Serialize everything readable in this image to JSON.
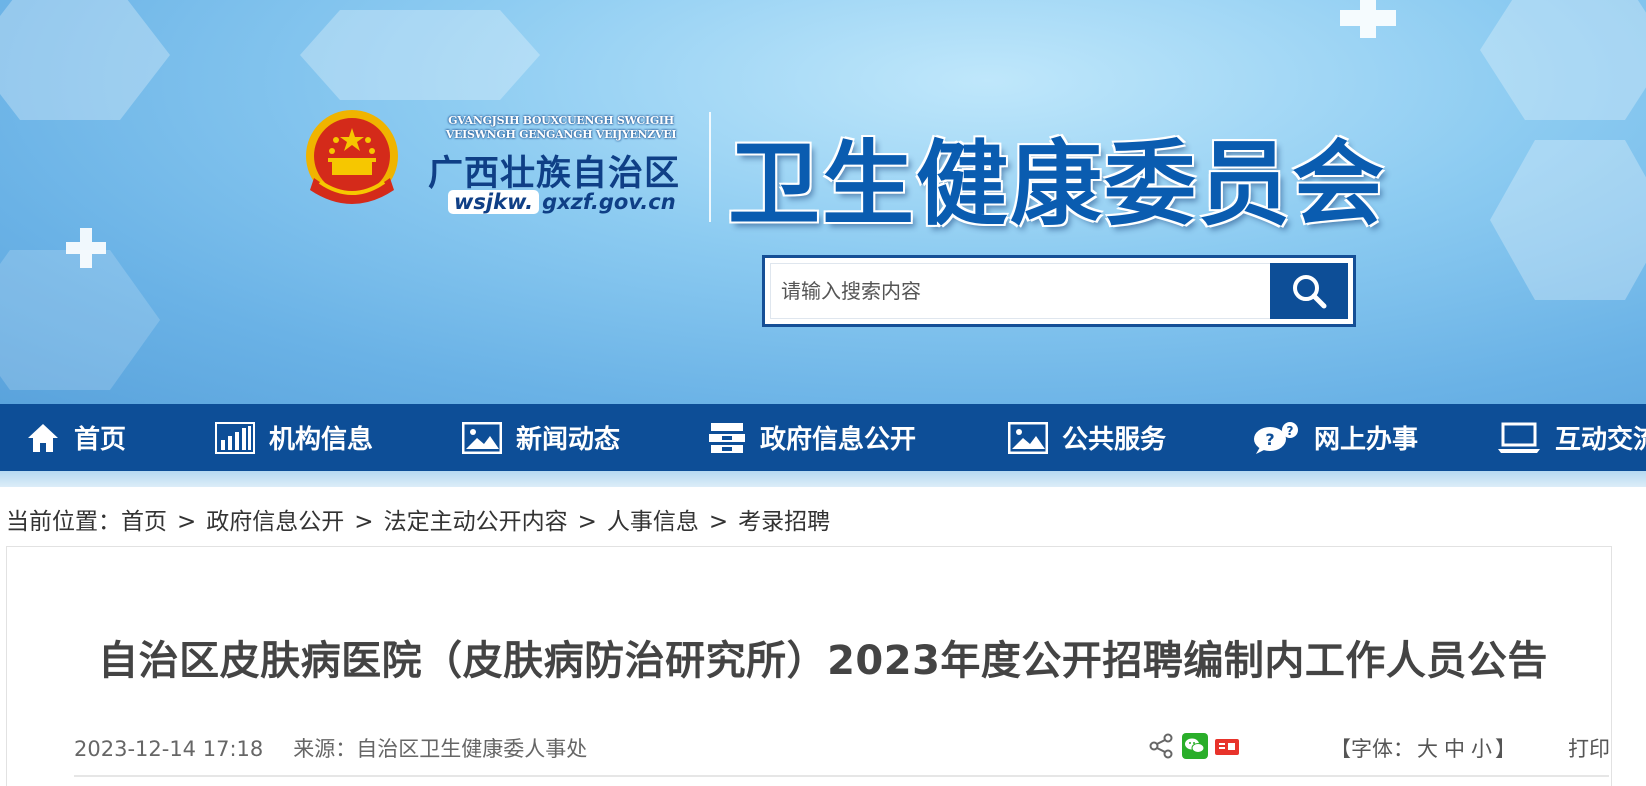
{
  "header": {
    "logo_pinyin_line1": "GVANGJSIH BOUXCUENGH SWCIGIH",
    "logo_pinyin_line2": "VEISWNGH GENGANGH VEIJYENZVEI",
    "logo_region": "广西壮族自治区",
    "logo_url_prefix": "wsjkw.",
    "logo_url_domain": "gxzf.gov.cn",
    "site_title": "卫生健康委员会"
  },
  "search": {
    "placeholder": "请输入搜索内容"
  },
  "nav": {
    "items": [
      {
        "label": "首页",
        "icon": "home-icon"
      },
      {
        "label": "机构信息",
        "icon": "bar-chart-icon"
      },
      {
        "label": "新闻动态",
        "icon": "image-icon"
      },
      {
        "label": "政府信息公开",
        "icon": "cabinet-icon"
      },
      {
        "label": "公共服务",
        "icon": "image-icon"
      },
      {
        "label": "网上办事",
        "icon": "chat-bubble-icon"
      },
      {
        "label": "互动交流",
        "icon": "laptop-icon"
      }
    ]
  },
  "breadcrumb": {
    "prefix": "当前位置：",
    "items": [
      "首页",
      "政府信息公开",
      "法定主动公开内容",
      "人事信息",
      "考录招聘"
    ],
    "separator": ">"
  },
  "article": {
    "title": "自治区皮肤病医院（皮肤病防治研究所）2023年度公开招聘编制内工作人员公告",
    "date": "2023-12-14 17:18",
    "source_label": "来源：",
    "source": "自治区卫生健康委人事处",
    "font_control": {
      "prefix": "【字体：",
      "large": "大",
      "medium": "中",
      "small": "小",
      "suffix": "】"
    },
    "print_label": "打印",
    "share_icons": [
      "share-icon",
      "wechat-icon",
      "toutiao-icon"
    ]
  },
  "colors": {
    "nav_bg": "#0d4e97",
    "title_blue": "#0a5cb0",
    "text": "#333333"
  }
}
